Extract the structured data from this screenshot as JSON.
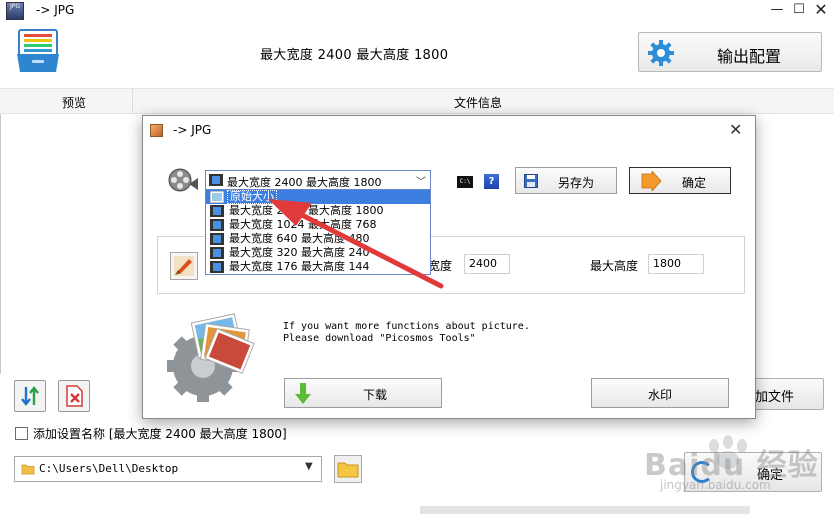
{
  "main_window": {
    "title": "-> JPG",
    "app_icon_label": "JPG",
    "minimize_glyph": "—",
    "maximize_glyph": "☐",
    "close_glyph": "✕",
    "size_summary": "最大宽度 2400 最大高度 1800",
    "output_config_label": "输出配置",
    "columns": {
      "preview": "预览",
      "file_info": "文件信息"
    },
    "add_file_label": "加文件",
    "add_setting_label": "添加设置名称 [最大宽度 2400 最大高度 1800]",
    "output_path": "C:\\Users\\Dell\\Desktop",
    "confirm_label": "确定"
  },
  "dialog": {
    "title": "-> JPG",
    "close_glyph": "✕",
    "preset_selected": "最大宽度 2400 最大高度 1800",
    "cmd_icon_label": "C:\\",
    "help_label": "?",
    "save_as_label": "另存为",
    "ok_label": "确定",
    "width_label": "宽度",
    "width_value": "2400",
    "height_label": "最大高度",
    "height_value": "1800",
    "promo_line_1": "If you want more functions about picture.",
    "promo_line_2": "Please download \"Picosmos Tools\"",
    "download_label": "下载",
    "watermark_label": "水印",
    "preset_options": [
      {
        "label": "原始大小",
        "selected": true
      },
      {
        "label": "最大宽度 2400 最大高度 1800",
        "selected": false
      },
      {
        "label": "最大宽度 1024 最大高度 768",
        "selected": false
      },
      {
        "label": "最大宽度 640 最大高度 480",
        "selected": false
      },
      {
        "label": "最大宽度 320 最大高度 240",
        "selected": false
      },
      {
        "label": "最大宽度 176 最大高度 144",
        "selected": false
      }
    ]
  },
  "watermark_brand": {
    "text": "Baidu 经验",
    "sub": "jingyan.baidu.com"
  },
  "colors": {
    "accent_blue": "#3d7fe0",
    "gear_blue": "#2b8fd8",
    "arrow_red": "#e03a3a"
  }
}
